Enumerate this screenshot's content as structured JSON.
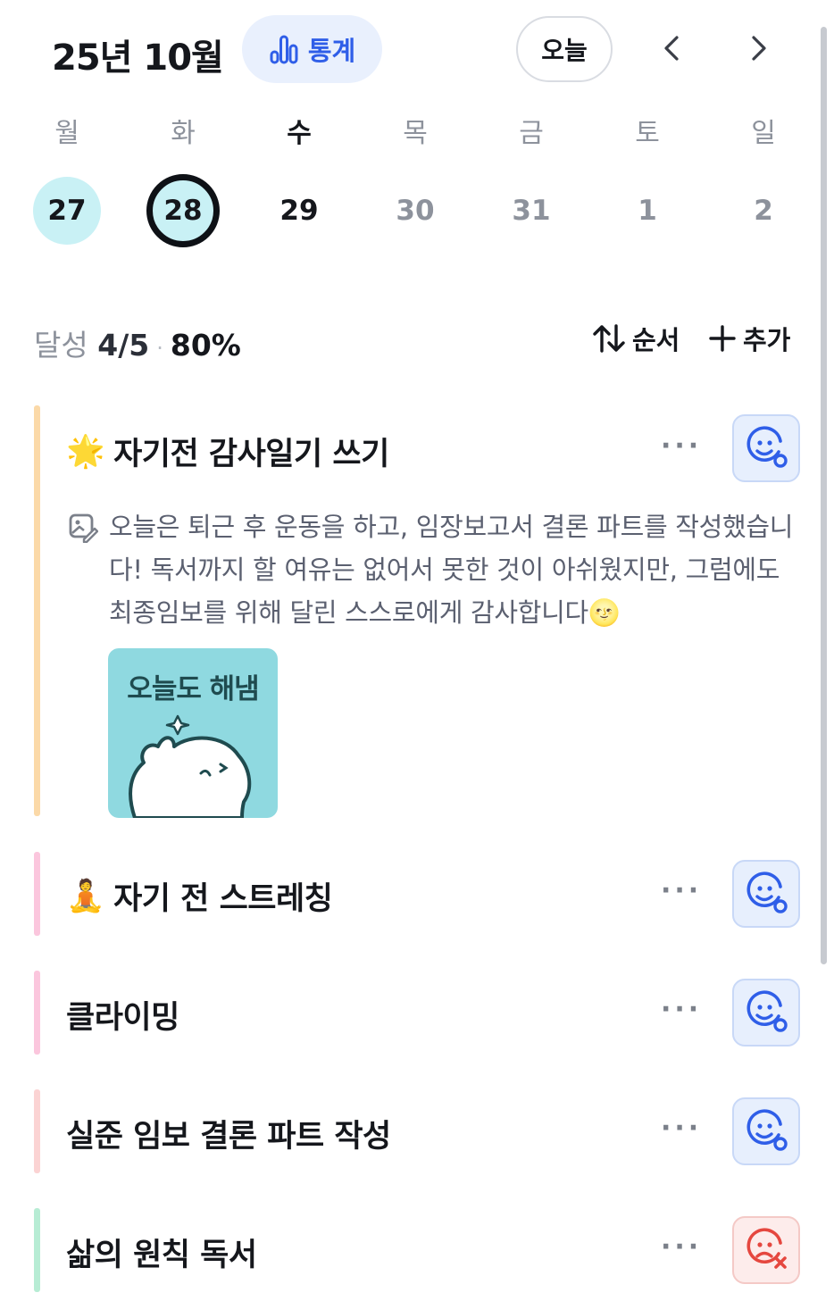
{
  "header": {
    "month_title": "25년 10월",
    "stats_label": "통계",
    "today_label": "오늘"
  },
  "week": {
    "days": [
      {
        "weekday": "월",
        "date": "27",
        "state": "done"
      },
      {
        "weekday": "화",
        "date": "28",
        "state": "selected"
      },
      {
        "weekday": "수",
        "date": "29",
        "state": "today"
      },
      {
        "weekday": "목",
        "date": "30",
        "state": "future"
      },
      {
        "weekday": "금",
        "date": "31",
        "state": "future"
      },
      {
        "weekday": "토",
        "date": "1",
        "state": "future"
      },
      {
        "weekday": "일",
        "date": "2",
        "state": "future"
      }
    ]
  },
  "summary": {
    "label": "달성",
    "count": "4/5",
    "separator": "·",
    "percent": "80%",
    "order_label": "순서",
    "add_label": "추가"
  },
  "habits": [
    {
      "emoji": "🌟",
      "title": "자기전 감사일기 쓰기",
      "color": "#fbd9a8",
      "status": "done",
      "note": "오늘은 퇴근 후 운동을 하고, 임장보고서 결론 파트를 작성했습니다! 독서까지 할 여유는 없어서 못한 것이 아쉬웠지만, 그럼에도 최종임보를 위해 달린 스스로에게 감사합니다🌝",
      "sticker_text": "오늘도 해냄"
    },
    {
      "emoji": "🧘",
      "title": "자기 전 스트레칭",
      "color": "#fbc6dd",
      "status": "done"
    },
    {
      "emoji": "",
      "title": "클라이밍",
      "color": "#fbc6dd",
      "status": "done"
    },
    {
      "emoji": "",
      "title": "실준 임보 결론 파트 작성",
      "color": "#fbd3d3",
      "status": "done"
    },
    {
      "emoji": "",
      "title": "삶의 원칙 독서",
      "color": "#b7ecd4",
      "status": "failed"
    }
  ],
  "more_label": "···",
  "colors": {
    "accent": "#2f5ee8",
    "done_date_bg": "#c9f1f5",
    "fail": "#e5473f"
  }
}
